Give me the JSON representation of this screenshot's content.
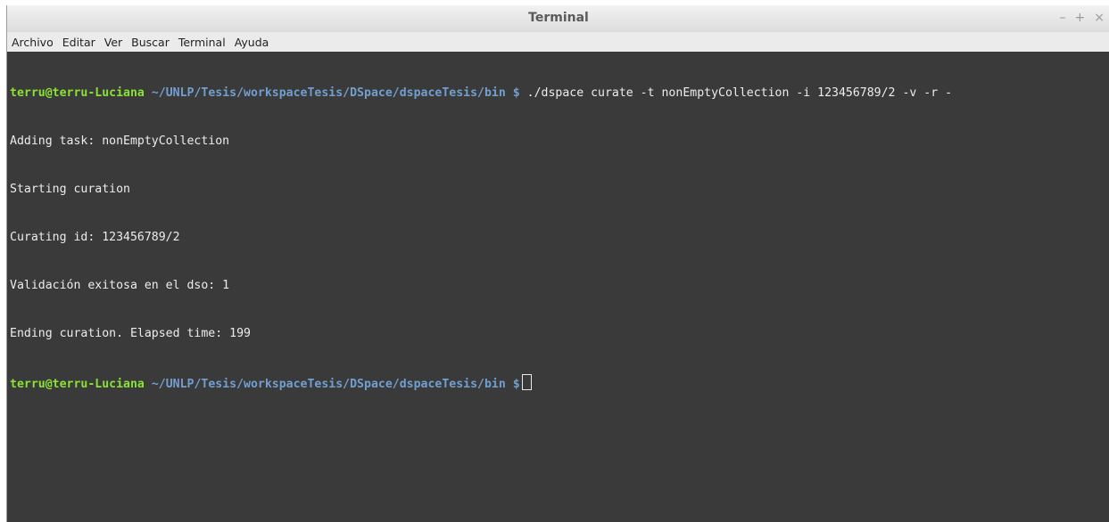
{
  "window": {
    "title": "Terminal",
    "controls": {
      "minimize": "–",
      "maximize": "+",
      "close": "×"
    }
  },
  "menu": {
    "items": [
      "Archivo",
      "Editar",
      "Ver",
      "Buscar",
      "Terminal",
      "Ayuda"
    ]
  },
  "prompt": {
    "user_host": "terru@terru-Luciana",
    "path": "~/UNLP/Tesis/workspaceTesis/DSpace/dspaceTesis/bin",
    "symbol": "$"
  },
  "command": " ./dspace curate -t nonEmptyCollection -i 123456789/2 -v -r -",
  "output": [
    "Adding task: nonEmptyCollection",
    "Starting curation",
    "Curating id: 123456789/2",
    "Validación exitosa en el dso: 1",
    "Ending curation. Elapsed time: 199"
  ],
  "colors": {
    "terminal_bg": "#3a3a3a",
    "text": "#ececec",
    "user_host": "#8ae234",
    "path": "#729fcf"
  }
}
